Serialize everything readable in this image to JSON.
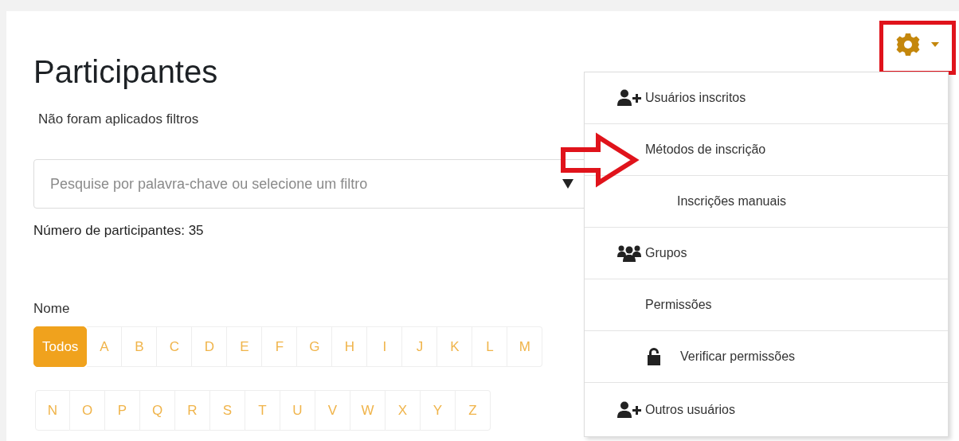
{
  "title": "Participantes",
  "filter_status": "Não foram aplicados filtros",
  "search": {
    "placeholder": "Pesquise por palavra-chave ou selecione um filtro"
  },
  "participant_count": "Número de participantes: 35",
  "name_filter": {
    "label": "Nome",
    "rows": [
      [
        {
          "label": "Todos",
          "selected": true
        },
        {
          "label": "A",
          "selected": false
        },
        {
          "label": "B",
          "selected": false
        },
        {
          "label": "C",
          "selected": false
        },
        {
          "label": "D",
          "selected": false
        },
        {
          "label": "E",
          "selected": false
        },
        {
          "label": "F",
          "selected": false
        },
        {
          "label": "G",
          "selected": false
        },
        {
          "label": "H",
          "selected": false
        },
        {
          "label": "I",
          "selected": false
        },
        {
          "label": "J",
          "selected": false
        },
        {
          "label": "K",
          "selected": false
        },
        {
          "label": "L",
          "selected": false
        },
        {
          "label": "M",
          "selected": false
        }
      ],
      [
        {
          "label": "N",
          "selected": false
        },
        {
          "label": "O",
          "selected": false
        },
        {
          "label": "P",
          "selected": false
        },
        {
          "label": "Q",
          "selected": false
        },
        {
          "label": "R",
          "selected": false
        },
        {
          "label": "S",
          "selected": false
        },
        {
          "label": "T",
          "selected": false
        },
        {
          "label": "U",
          "selected": false
        },
        {
          "label": "V",
          "selected": false
        },
        {
          "label": "W",
          "selected": false
        },
        {
          "label": "X",
          "selected": false
        },
        {
          "label": "Y",
          "selected": false
        },
        {
          "label": "Z",
          "selected": false
        }
      ]
    ]
  },
  "settings_menu": {
    "items": [
      {
        "label": "Usuários inscritos",
        "kind": "user-add"
      },
      {
        "label": "Métodos de inscrição",
        "kind": "plain",
        "children": [
          {
            "label": "Inscrições manuais",
            "kind": "plain"
          }
        ]
      },
      {
        "label": "Grupos",
        "kind": "group"
      },
      {
        "label": "Permissões",
        "kind": "plain",
        "children": [
          {
            "label": "Verificar permissões",
            "kind": "lock"
          }
        ]
      },
      {
        "label": "Outros usuários",
        "kind": "user-add"
      }
    ]
  }
}
